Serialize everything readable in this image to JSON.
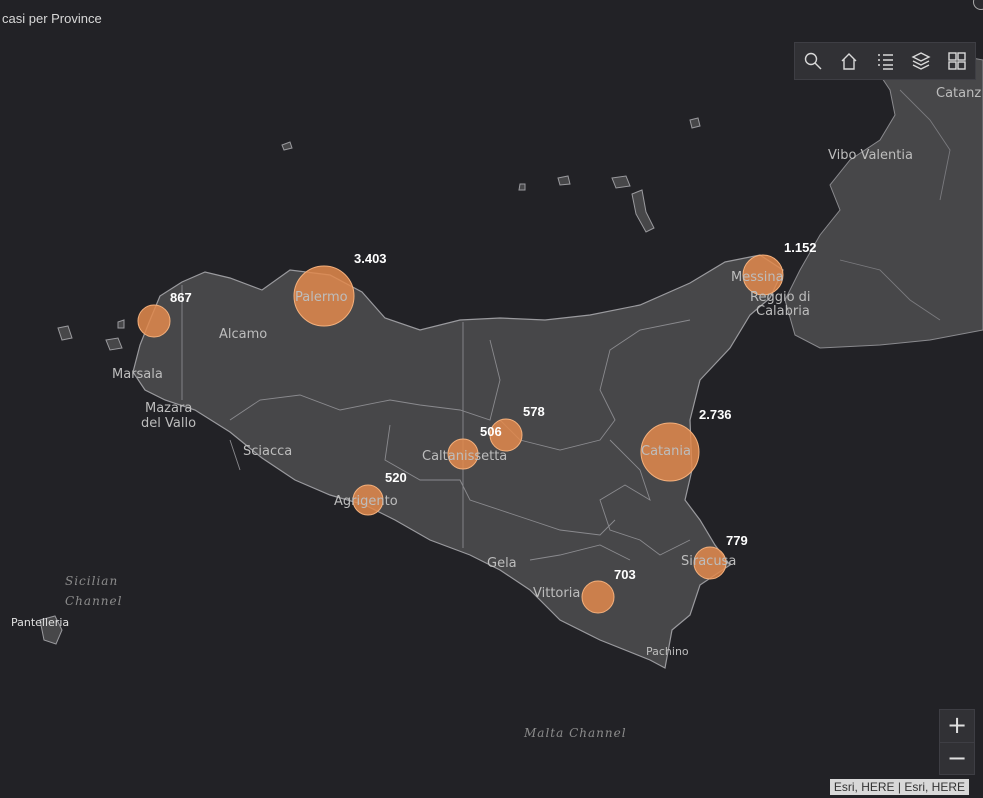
{
  "title": "casi per Province",
  "toolbar": {
    "search": "search-icon",
    "home": "home-icon",
    "legend": "legend-list-icon",
    "layers": "layers-icon",
    "basemap": "basemap-gallery-icon"
  },
  "zoom": {
    "in_label": "+",
    "out_label": "−"
  },
  "attribution": "Esri, HERE | Esri, HERE",
  "colors": {
    "background": "#222226",
    "land": "#474749",
    "bubble": "#e38a4c"
  },
  "cities": {
    "catanz": "Catanz",
    "vibo": "Vibo Valentia",
    "messina": "Messina",
    "reggio1": "Reggio di",
    "reggio2": "Calabria",
    "palermo": "Palermo",
    "alcamo": "Alcamo",
    "marsala": "Marsala",
    "mazara1": "Mazara",
    "mazara2": "del Vallo",
    "sciacca": "Sciacca",
    "caltanissetta": "Caltanissetta",
    "agrigento": "Agrigento",
    "catania": "Catania",
    "siracusa": "Siracusa",
    "gela": "Gela",
    "vittoria": "Vittoria",
    "pachino": "Pachino",
    "pantelleria": "Pantelleria"
  },
  "water": {
    "sicilian1": "Sicilian",
    "sicilian2": "Channel",
    "malta": "Malta Channel"
  },
  "cases": {
    "palermo": "3.403",
    "trapani": "867",
    "messina": "1.152",
    "catania": "2.736",
    "enna": "578",
    "caltanissetta": "506",
    "agrigento": "520",
    "siracusa": "779",
    "ragusa": "703"
  }
}
